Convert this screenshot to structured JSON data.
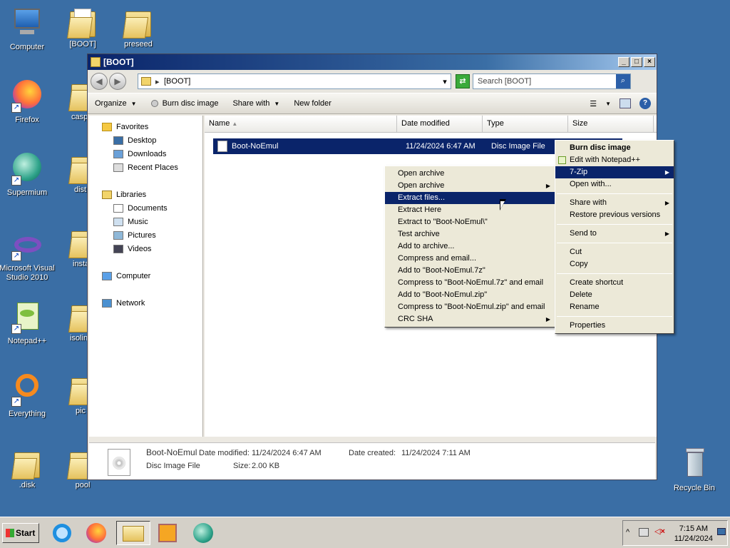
{
  "desktop": {
    "icons": [
      "Computer",
      "[BOOT]",
      "preseed",
      "Firefox",
      "casp",
      "Supermium",
      "dist",
      "Microsoft Visual Studio 2010",
      "insta",
      "Notepad++",
      "isolin",
      "Everything",
      "pic",
      ".disk",
      "pool",
      "Recycle Bin"
    ]
  },
  "window": {
    "title": "[BOOT]",
    "address": "[BOOT]",
    "search_placeholder": "Search [BOOT]",
    "toolbar": {
      "organize": "Organize",
      "burn": "Burn disc image",
      "share": "Share with",
      "new_folder": "New folder"
    },
    "nav": {
      "favorites": "Favorites",
      "desktop": "Desktop",
      "downloads": "Downloads",
      "recent": "Recent Places",
      "libraries": "Libraries",
      "documents": "Documents",
      "music": "Music",
      "pictures": "Pictures",
      "videos": "Videos",
      "computer": "Computer",
      "network": "Network"
    },
    "columns": {
      "name": "Name",
      "date": "Date modified",
      "type": "Type",
      "size": "Size"
    },
    "file": {
      "name": "Boot-NoEmul",
      "date": "11/24/2024 6:47 AM",
      "type": "Disc Image File"
    },
    "details": {
      "name": "Boot-NoEmul",
      "type": "Disc Image File",
      "modified_label": "Date modified:",
      "modified": "11/24/2024 6:47 AM",
      "created_label": "Date created:",
      "created": "11/24/2024 7:11 AM",
      "size_label": "Size:",
      "size": "2.00 KB"
    }
  },
  "context_menu": {
    "items": [
      "Burn disc image",
      "Edit with Notepad++",
      "7-Zip",
      "Open with...",
      "Share with",
      "Restore previous versions",
      "Send to",
      "Cut",
      "Copy",
      "Create shortcut",
      "Delete",
      "Rename",
      "Properties"
    ]
  },
  "zip_menu": {
    "items": [
      "Open archive",
      "Open archive",
      "Extract files...",
      "Extract Here",
      "Extract to \"Boot-NoEmul\\\"",
      "Test archive",
      "Add to archive...",
      "Compress and email...",
      "Add to \"Boot-NoEmul.7z\"",
      "Compress to \"Boot-NoEmul.7z\" and email",
      "Add to \"Boot-NoEmul.zip\"",
      "Compress to \"Boot-NoEmul.zip\" and email",
      "CRC SHA"
    ]
  },
  "taskbar": {
    "start": "Start",
    "time": "7:15 AM",
    "date": "11/24/2024"
  }
}
